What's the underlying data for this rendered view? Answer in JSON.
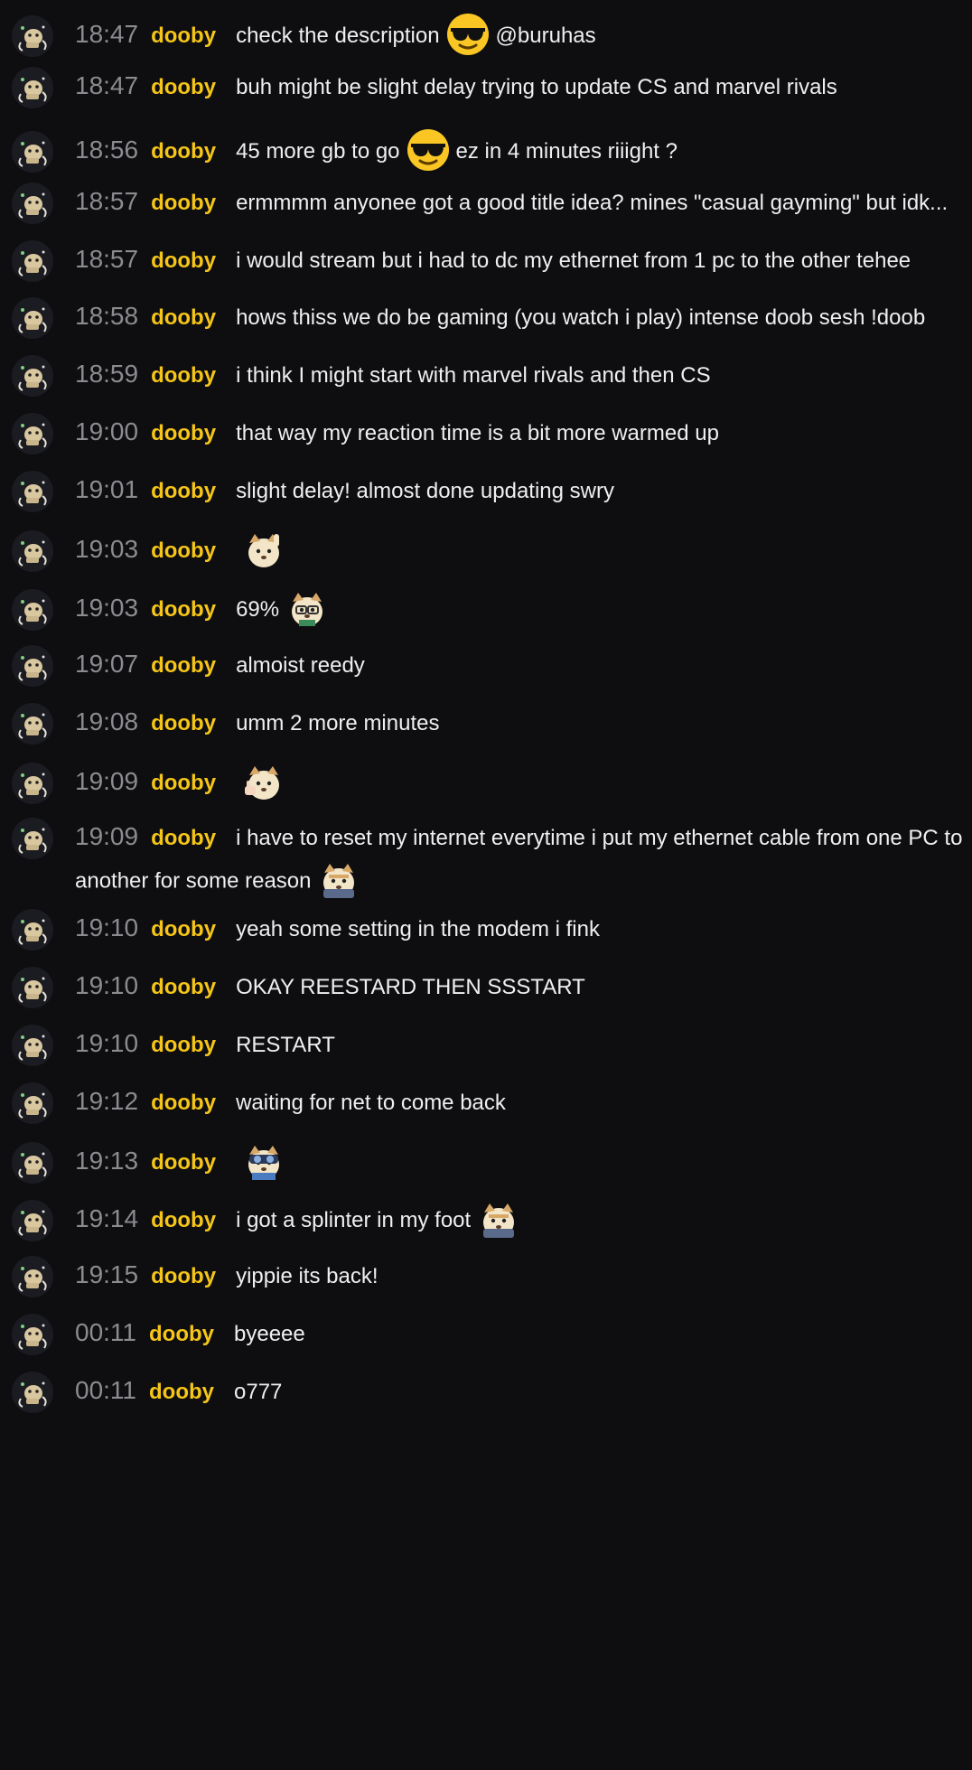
{
  "channel": {
    "username": "dooby",
    "username_color": "#f5c518"
  },
  "messages": [
    {
      "time": "18:47",
      "user": "dooby",
      "parts": [
        {
          "t": "text",
          "v": "check the description"
        },
        {
          "t": "emote",
          "v": "sunglasses-emoji"
        },
        {
          "t": "text",
          "v": "@buruhas"
        }
      ]
    },
    {
      "time": "18:47",
      "user": "dooby",
      "parts": [
        {
          "t": "text",
          "v": "buh might be slight delay trying to update CS and marvel rivals"
        }
      ]
    },
    {
      "time": "18:56",
      "user": "dooby",
      "parts": [
        {
          "t": "text",
          "v": "45 more gb to go"
        },
        {
          "t": "emote",
          "v": "sunglasses-emoji"
        },
        {
          "t": "text",
          "v": "ez in 4 minutes riiight ?"
        }
      ]
    },
    {
      "time": "18:57",
      "user": "dooby",
      "parts": [
        {
          "t": "text",
          "v": "ermmmm anyonee got a good title idea? mines \"casual gayming\" but idk..."
        }
      ]
    },
    {
      "time": "18:57",
      "user": "dooby",
      "parts": [
        {
          "t": "text",
          "v": "i would stream but i had to dc my ethernet from 1 pc to the other tehee"
        }
      ]
    },
    {
      "time": "18:58",
      "user": "dooby",
      "parts": [
        {
          "t": "text",
          "v": "hows thiss we do be gaming (you watch i play) intense doob sesh !doob"
        }
      ]
    },
    {
      "time": "18:59",
      "user": "dooby",
      "parts": [
        {
          "t": "text",
          "v": "i think I might start with marvel rivals and then CS"
        }
      ]
    },
    {
      "time": "19:00",
      "user": "dooby",
      "parts": [
        {
          "t": "text",
          "v": "that way my reaction time is a bit more warmed up"
        }
      ]
    },
    {
      "time": "19:01",
      "user": "dooby",
      "parts": [
        {
          "t": "text",
          "v": "slight delay! almost done updating swry"
        }
      ]
    },
    {
      "time": "19:03",
      "user": "dooby",
      "parts": [
        {
          "t": "emote",
          "v": "dog-wave-emote"
        }
      ]
    },
    {
      "time": "19:03",
      "user": "dooby",
      "parts": [
        {
          "t": "text",
          "v": "69%"
        },
        {
          "t": "emote",
          "v": "dog-glasses-emote"
        }
      ]
    },
    {
      "time": "19:07",
      "user": "dooby",
      "parts": [
        {
          "t": "text",
          "v": "almoist reedy"
        }
      ]
    },
    {
      "time": "19:08",
      "user": "dooby",
      "parts": [
        {
          "t": "text",
          "v": "umm 2 more minutes"
        }
      ]
    },
    {
      "time": "19:09",
      "user": "dooby",
      "parts": [
        {
          "t": "emote",
          "v": "dog-thumb-emote"
        }
      ]
    },
    {
      "time": "19:09",
      "user": "dooby",
      "wrap": true,
      "parts": [
        {
          "t": "text",
          "v": "i have to reset my internet everytime i put my ethernet cable from one PC to another for some reason"
        },
        {
          "t": "emote",
          "v": "dog-hide-emote"
        }
      ]
    },
    {
      "time": "19:10",
      "user": "dooby",
      "parts": [
        {
          "t": "text",
          "v": "yeah some setting in the modem i fink"
        }
      ]
    },
    {
      "time": "19:10",
      "user": "dooby",
      "parts": [
        {
          "t": "text",
          "v": "OKAY REESTARD THEN SSSTART"
        }
      ]
    },
    {
      "time": "19:10",
      "user": "dooby",
      "parts": [
        {
          "t": "text",
          "v": "RESTART"
        }
      ]
    },
    {
      "time": "19:12",
      "user": "dooby",
      "parts": [
        {
          "t": "text",
          "v": "waiting for net to come back"
        }
      ]
    },
    {
      "time": "19:13",
      "user": "dooby",
      "parts": [
        {
          "t": "emote",
          "v": "dog-goggles-emote"
        }
      ]
    },
    {
      "time": "19:14",
      "user": "dooby",
      "parts": [
        {
          "t": "text",
          "v": "i got a splinter in my foot"
        },
        {
          "t": "emote",
          "v": "dog-hide-emote"
        }
      ]
    },
    {
      "time": "19:15",
      "user": "dooby",
      "parts": [
        {
          "t": "text",
          "v": "yippie its back!"
        }
      ]
    },
    {
      "time": "00:11",
      "user": "dooby",
      "parts": [
        {
          "t": "text",
          "v": "byeeee"
        }
      ]
    },
    {
      "time": "00:11",
      "user": "dooby",
      "parts": [
        {
          "t": "text",
          "v": "o777"
        }
      ]
    }
  ]
}
